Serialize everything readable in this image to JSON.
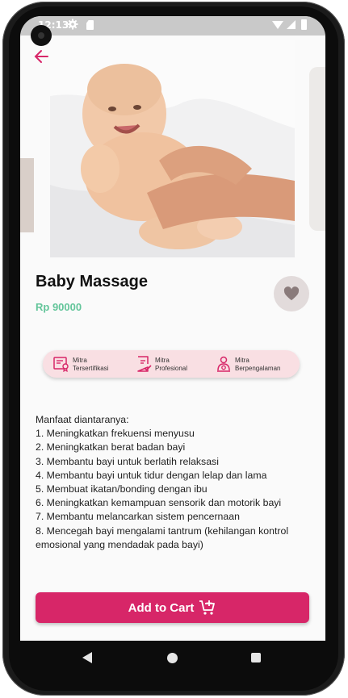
{
  "status_bar": {
    "time": "12:13"
  },
  "product": {
    "title": "Baby Massage",
    "price": "Rp 90000"
  },
  "badges": [
    {
      "line1": "Mitra",
      "line2": "Tersertifikasi",
      "icon": "certificate-icon"
    },
    {
      "line1": "Mitra",
      "line2": "Profesional",
      "icon": "checklist-icon"
    },
    {
      "line1": "Mitra",
      "line2": "Berpengalaman",
      "icon": "person-badge-icon"
    }
  ],
  "description": {
    "intro": "Manfaat diantaranya:",
    "items": [
      "1. Meningkatkan frekuensi menyusu",
      "2. Meningkatkan berat badan bayi",
      "3. Membantu bayi untuk berlatih relaksasi",
      "4. Membantu bayi untuk tidur dengan lelap dan lama",
      "5. Membuat ikatan/bonding dengan ibu",
      "6. Meningkatkan kemampuan sensorik dan motorik bayi",
      "7. Membantu melancarkan sistem pencernaan",
      "8. Mencegah bayi mengalami tantrum (kehilangan kontrol emosional yang mendadak pada bayi)"
    ]
  },
  "cart_button": {
    "label": "Add to Cart"
  },
  "colors": {
    "accent": "#d72668",
    "price": "#63c59a",
    "badge_bg": "#f9dfe3"
  }
}
